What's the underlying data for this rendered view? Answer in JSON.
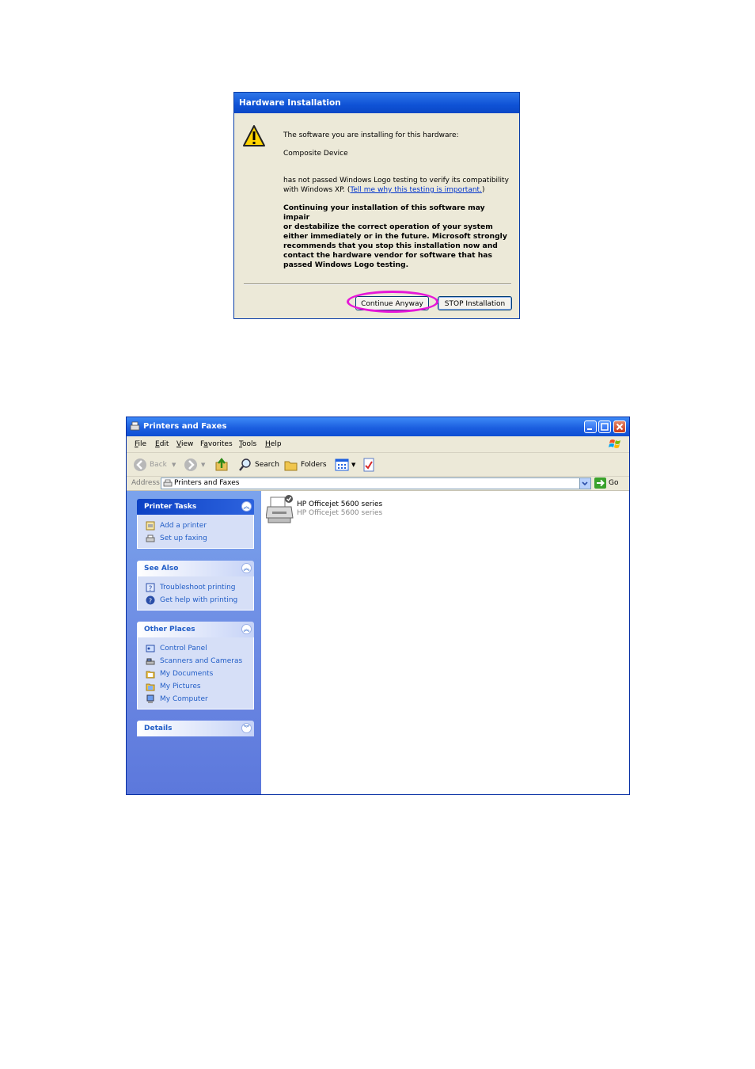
{
  "dialog": {
    "title": "Hardware Installation",
    "intro": "The software you are installing for this hardware:",
    "device": "Composite Device",
    "logo_line1": "has not passed Windows Logo testing to verify its compatibility",
    "logo_line2_prefix": "with Windows XP. (",
    "logo_link": "Tell me why this testing is important.",
    "logo_line2_suffix": ")",
    "warning": [
      "Continuing your installation of this software may impair",
      "or destabilize the correct operation of your system",
      "either immediately or in the future. Microsoft strongly",
      "recommends that you stop this installation now and",
      "contact the hardware vendor for software that has",
      "passed Windows Logo testing."
    ],
    "continue_button": "Continue Anyway",
    "stop_button": "STOP Installation",
    "highlight_color": "#e617d8"
  },
  "window": {
    "title": "Printers and Faxes",
    "menu": [
      {
        "key": "F",
        "rest": "ile"
      },
      {
        "key": "E",
        "rest": "dit"
      },
      {
        "key": "V",
        "rest": "iew"
      },
      {
        "key": "",
        "pre": "F",
        "key2": "a",
        "rest": "vorites"
      },
      {
        "key": "T",
        "rest": "ools"
      },
      {
        "key": "H",
        "rest": "elp"
      }
    ],
    "toolbar": {
      "back": "Back",
      "search": "Search",
      "folders": "Folders"
    },
    "address": {
      "label": "Address",
      "value": "Printers and Faxes",
      "go": "Go"
    },
    "panels": [
      {
        "title": "Printer Tasks",
        "items": [
          "Add a printer",
          "Set up faxing"
        ]
      },
      {
        "title": "See Also",
        "items": [
          "Troubleshoot printing",
          "Get help with printing"
        ]
      },
      {
        "title": "Other Places",
        "items": [
          "Control Panel",
          "Scanners and Cameras",
          "My Documents",
          "My Pictures",
          "My Computer"
        ]
      },
      {
        "title": "Details",
        "items": []
      }
    ],
    "printer": {
      "name": "HP Officejet 5600 series",
      "model": "HP Officejet 5600 series"
    }
  }
}
